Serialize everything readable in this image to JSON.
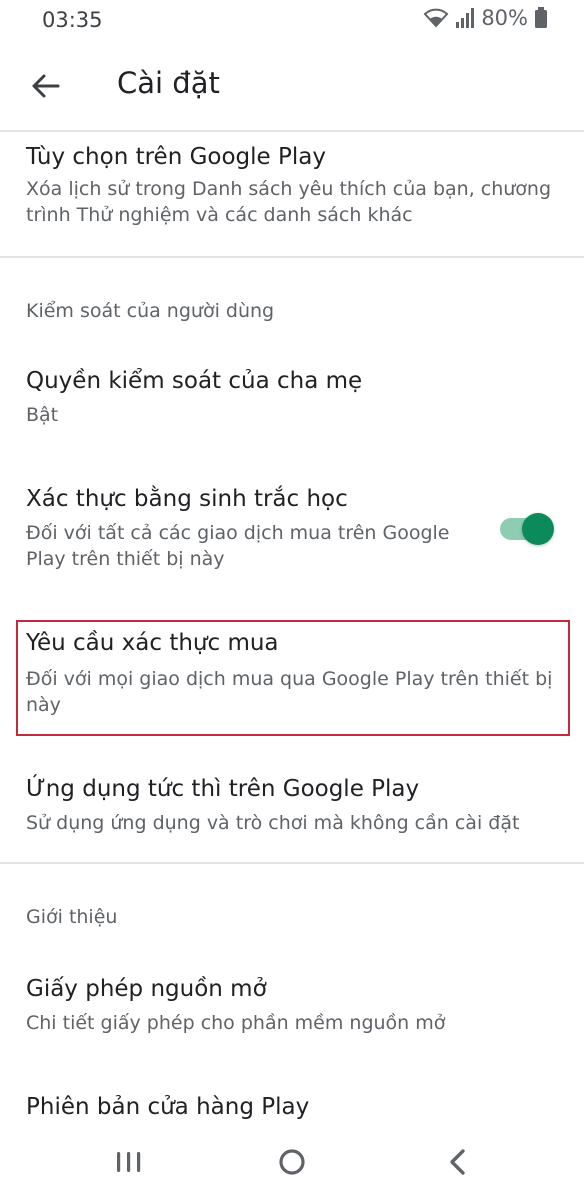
{
  "status_bar": {
    "time": "03:35",
    "battery": "80%",
    "icons": [
      "wifi-icon",
      "signal-icon",
      "battery-icon"
    ]
  },
  "app_bar": {
    "title": "Cài đặt",
    "back_icon": "arrow-back-icon"
  },
  "items": [
    {
      "title": "Tùy chọn trên Google Play",
      "subtitle_lines": [
        "Xóa lịch sử trong Danh sách yêu thích của bạn, chương",
        "trình Thử nghiệm và các danh sách khác"
      ]
    },
    {
      "title": "Quyền kiểm soát của cha mẹ",
      "subtitle_lines": [
        "Bật"
      ]
    },
    {
      "title": "Xác thực bằng sinh trắc học",
      "subtitle_lines": [
        "Đối với tất cả các giao dịch mua trên Google",
        "Play trên thiết bị này"
      ],
      "toggle_on": true
    },
    {
      "title": "Yêu cầu xác thực mua",
      "subtitle_lines": [
        "Đối với mọi giao dịch mua qua Google Play trên thiết bị",
        "này"
      ]
    },
    {
      "title": "Ứng dụng tức thì trên Google Play",
      "subtitle_lines": [
        "Sử dụng ứng dụng và trò chơi mà không cần cài đặt"
      ]
    },
    {
      "title": "Giấy phép nguồn mở",
      "subtitle_lines": [
        "Chi tiết giấy phép cho phần mềm nguồn mở"
      ]
    },
    {
      "title": "Phiên bản cửa hàng Play",
      "subtitle_lines": []
    }
  ],
  "sections": {
    "user_controls": "Kiểm soát của người dùng",
    "about": "Giới thiệu"
  },
  "colors": {
    "accent": "#0b8a5c",
    "toggle_track": "#8fcdb3",
    "highlight_border": "#c5283d"
  },
  "nav_bar": {
    "icons": [
      "recent-apps-icon",
      "home-icon",
      "back-icon"
    ]
  }
}
